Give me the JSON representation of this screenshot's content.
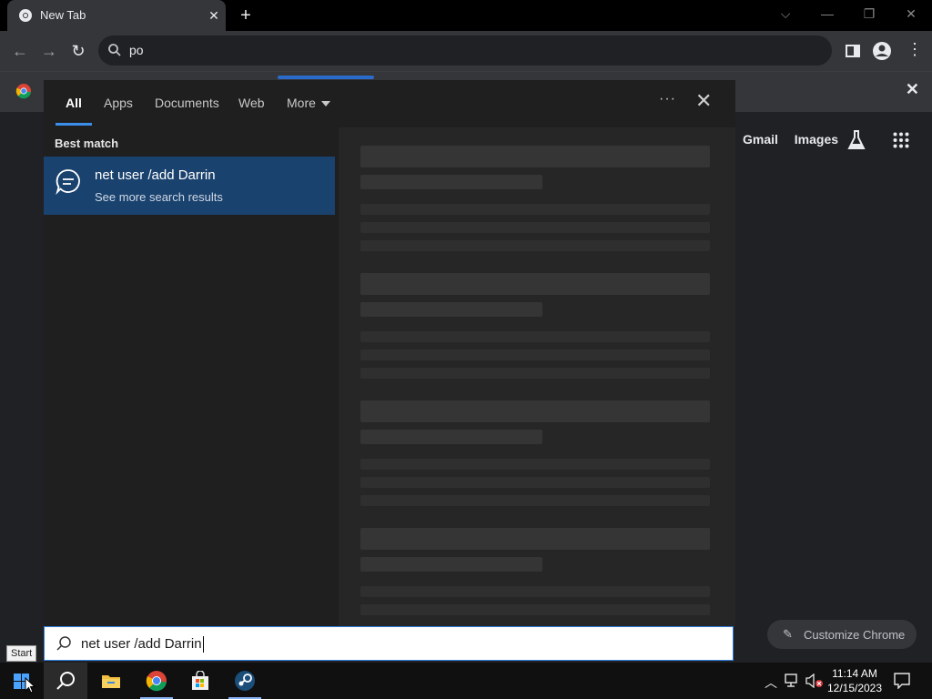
{
  "browser": {
    "tab_title": "New Tab",
    "omnibox_text": "po",
    "ntp_links": [
      "Gmail",
      "Images"
    ],
    "customize_label": "Customize Chrome"
  },
  "search_panel": {
    "tabs": [
      "All",
      "Apps",
      "Documents",
      "Web",
      "More"
    ],
    "active_tab": "All",
    "best_match_heading": "Best match",
    "best_match_title": "net user /add Darrin",
    "best_match_subtitle": "See more search results"
  },
  "search_box": {
    "value": "net user /add Darrin"
  },
  "tooltip": {
    "start": "Start"
  },
  "clock": {
    "time": "11:14 AM",
    "date": "12/15/2023"
  },
  "colors": {
    "accent": "#2e7bd6",
    "selection": "#19426e"
  },
  "icons": {
    "favicon": "chrome-icon",
    "search": "search-icon",
    "chat": "chat-bubble-icon",
    "taskbar": [
      "windows-start-icon",
      "search-icon",
      "file-explorer-icon",
      "chrome-icon",
      "store-icon",
      "steam-icon"
    ]
  }
}
